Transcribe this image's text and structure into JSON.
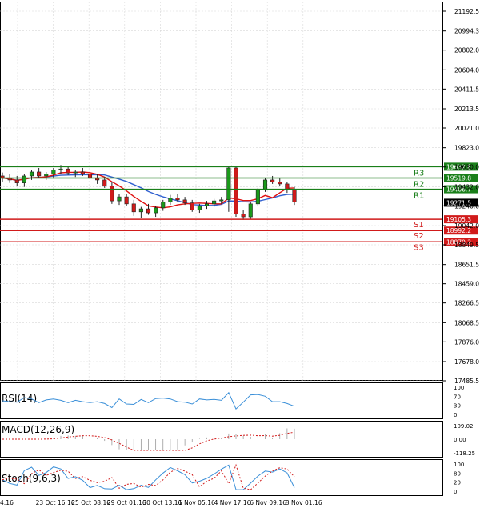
{
  "chart_data": {
    "type": "candlestick",
    "main_panel": {
      "price_axis_ticks": [
        "21192.5",
        "20994.3",
        "20802.0",
        "20604.0",
        "20411.5",
        "20213.5",
        "20021.0",
        "19823.0",
        "19630.0",
        "19432.0",
        "19240.0",
        "19042.0",
        "18849.5",
        "18651.5",
        "18459.0",
        "18266.5",
        "18068.5",
        "17876.0",
        "17678.0",
        "17485.5"
      ],
      "ylim": [
        17485.5,
        21192.5
      ],
      "date_labels": [
        "4:16",
        "23 Oct 16:16",
        "25 Oct 08:16",
        "29 Oct 01:16",
        "30 Oct 13:16",
        "1 Nov 05:16",
        "4 Nov 17:16",
        "6 Nov 09:16",
        "8 Nov 01:16"
      ],
      "levels": [
        {
          "name": "R3",
          "value": 19632.8,
          "label": "19632.8",
          "color": "#1a7f1a"
        },
        {
          "name": "R2",
          "value": 19519.8,
          "label": "19519.8",
          "color": "#1a7f1a"
        },
        {
          "name": "R1",
          "value": 19406.7,
          "label": "19406.7",
          "color": "#1a7f1a"
        },
        {
          "name": "S1",
          "value": 19105.3,
          "label": "19105.3",
          "color": "#d11a1a"
        },
        {
          "name": "S2",
          "value": 18992.2,
          "label": "18992.2",
          "color": "#d11a1a"
        },
        {
          "name": "S3",
          "value": 18879.2,
          "label": "18879.2",
          "color": "#d11a1a"
        }
      ],
      "current_price": {
        "value": 19271.5,
        "label": "19271.5"
      },
      "candles": [
        {
          "o": 19540,
          "h": 19575,
          "l": 19480,
          "c": 19520
        },
        {
          "o": 19520,
          "h": 19560,
          "l": 19470,
          "c": 19500
        },
        {
          "o": 19500,
          "h": 19540,
          "l": 19440,
          "c": 19470
        },
        {
          "o": 19470,
          "h": 19560,
          "l": 19430,
          "c": 19540
        },
        {
          "o": 19540,
          "h": 19600,
          "l": 19500,
          "c": 19580
        },
        {
          "o": 19580,
          "h": 19620,
          "l": 19520,
          "c": 19540
        },
        {
          "o": 19540,
          "h": 19580,
          "l": 19500,
          "c": 19560
        },
        {
          "o": 19560,
          "h": 19620,
          "l": 19520,
          "c": 19600
        },
        {
          "o": 19600,
          "h": 19650,
          "l": 19560,
          "c": 19610
        },
        {
          "o": 19610,
          "h": 19640,
          "l": 19550,
          "c": 19570
        },
        {
          "o": 19570,
          "h": 19600,
          "l": 19530,
          "c": 19580
        },
        {
          "o": 19580,
          "h": 19620,
          "l": 19540,
          "c": 19560
        },
        {
          "o": 19560,
          "h": 19600,
          "l": 19500,
          "c": 19520
        },
        {
          "o": 19520,
          "h": 19560,
          "l": 19460,
          "c": 19500
        },
        {
          "o": 19500,
          "h": 19530,
          "l": 19420,
          "c": 19440
        },
        {
          "o": 19440,
          "h": 19480,
          "l": 19260,
          "c": 19290
        },
        {
          "o": 19290,
          "h": 19360,
          "l": 19250,
          "c": 19330
        },
        {
          "o": 19330,
          "h": 19360,
          "l": 19240,
          "c": 19260
        },
        {
          "o": 19260,
          "h": 19300,
          "l": 19140,
          "c": 19180
        },
        {
          "o": 19180,
          "h": 19230,
          "l": 19120,
          "c": 19210
        },
        {
          "o": 19210,
          "h": 19260,
          "l": 19150,
          "c": 19170
        },
        {
          "o": 19170,
          "h": 19240,
          "l": 19130,
          "c": 19220
        },
        {
          "o": 19220,
          "h": 19300,
          "l": 19190,
          "c": 19280
        },
        {
          "o": 19280,
          "h": 19350,
          "l": 19250,
          "c": 19320
        },
        {
          "o": 19320,
          "h": 19360,
          "l": 19280,
          "c": 19300
        },
        {
          "o": 19300,
          "h": 19330,
          "l": 19250,
          "c": 19270
        },
        {
          "o": 19270,
          "h": 19300,
          "l": 19180,
          "c": 19200
        },
        {
          "o": 19200,
          "h": 19260,
          "l": 19170,
          "c": 19240
        },
        {
          "o": 19240,
          "h": 19290,
          "l": 19210,
          "c": 19260
        },
        {
          "o": 19260,
          "h": 19310,
          "l": 19230,
          "c": 19290
        },
        {
          "o": 19290,
          "h": 19330,
          "l": 19260,
          "c": 19300
        },
        {
          "o": 19300,
          "h": 19640,
          "l": 19180,
          "c": 19620
        },
        {
          "o": 19620,
          "h": 19640,
          "l": 19130,
          "c": 19160
        },
        {
          "o": 19160,
          "h": 19200,
          "l": 19100,
          "c": 19130
        },
        {
          "o": 19130,
          "h": 19280,
          "l": 19110,
          "c": 19260
        },
        {
          "o": 19260,
          "h": 19420,
          "l": 19240,
          "c": 19400
        },
        {
          "o": 19400,
          "h": 19520,
          "l": 19380,
          "c": 19500
        },
        {
          "o": 19500,
          "h": 19540,
          "l": 19460,
          "c": 19480
        },
        {
          "o": 19480,
          "h": 19520,
          "l": 19440,
          "c": 19460
        },
        {
          "o": 19460,
          "h": 19480,
          "l": 19370,
          "c": 19400
        },
        {
          "o": 19400,
          "h": 19430,
          "l": 19250,
          "c": 19280
        }
      ]
    },
    "rsi_panel": {
      "title": "RSI(14)",
      "ticks": [
        "100",
        "70",
        "30",
        "0"
      ]
    },
    "macd_panel": {
      "title": "MACD(12,26,9)",
      "ticks": [
        "109.02",
        "0.00",
        "-118.25"
      ]
    },
    "stoch_panel": {
      "title": "Stoch(9,6,3)",
      "ticks": [
        "100",
        "80",
        "20",
        "0"
      ]
    },
    "colors": {
      "up": "#1a9a1a",
      "down": "#d11a1a",
      "ma_red": "#e01010",
      "ma_blue": "#3060d0",
      "grid": "#d8d8d8",
      "rsi": "#3a8fd8"
    }
  }
}
